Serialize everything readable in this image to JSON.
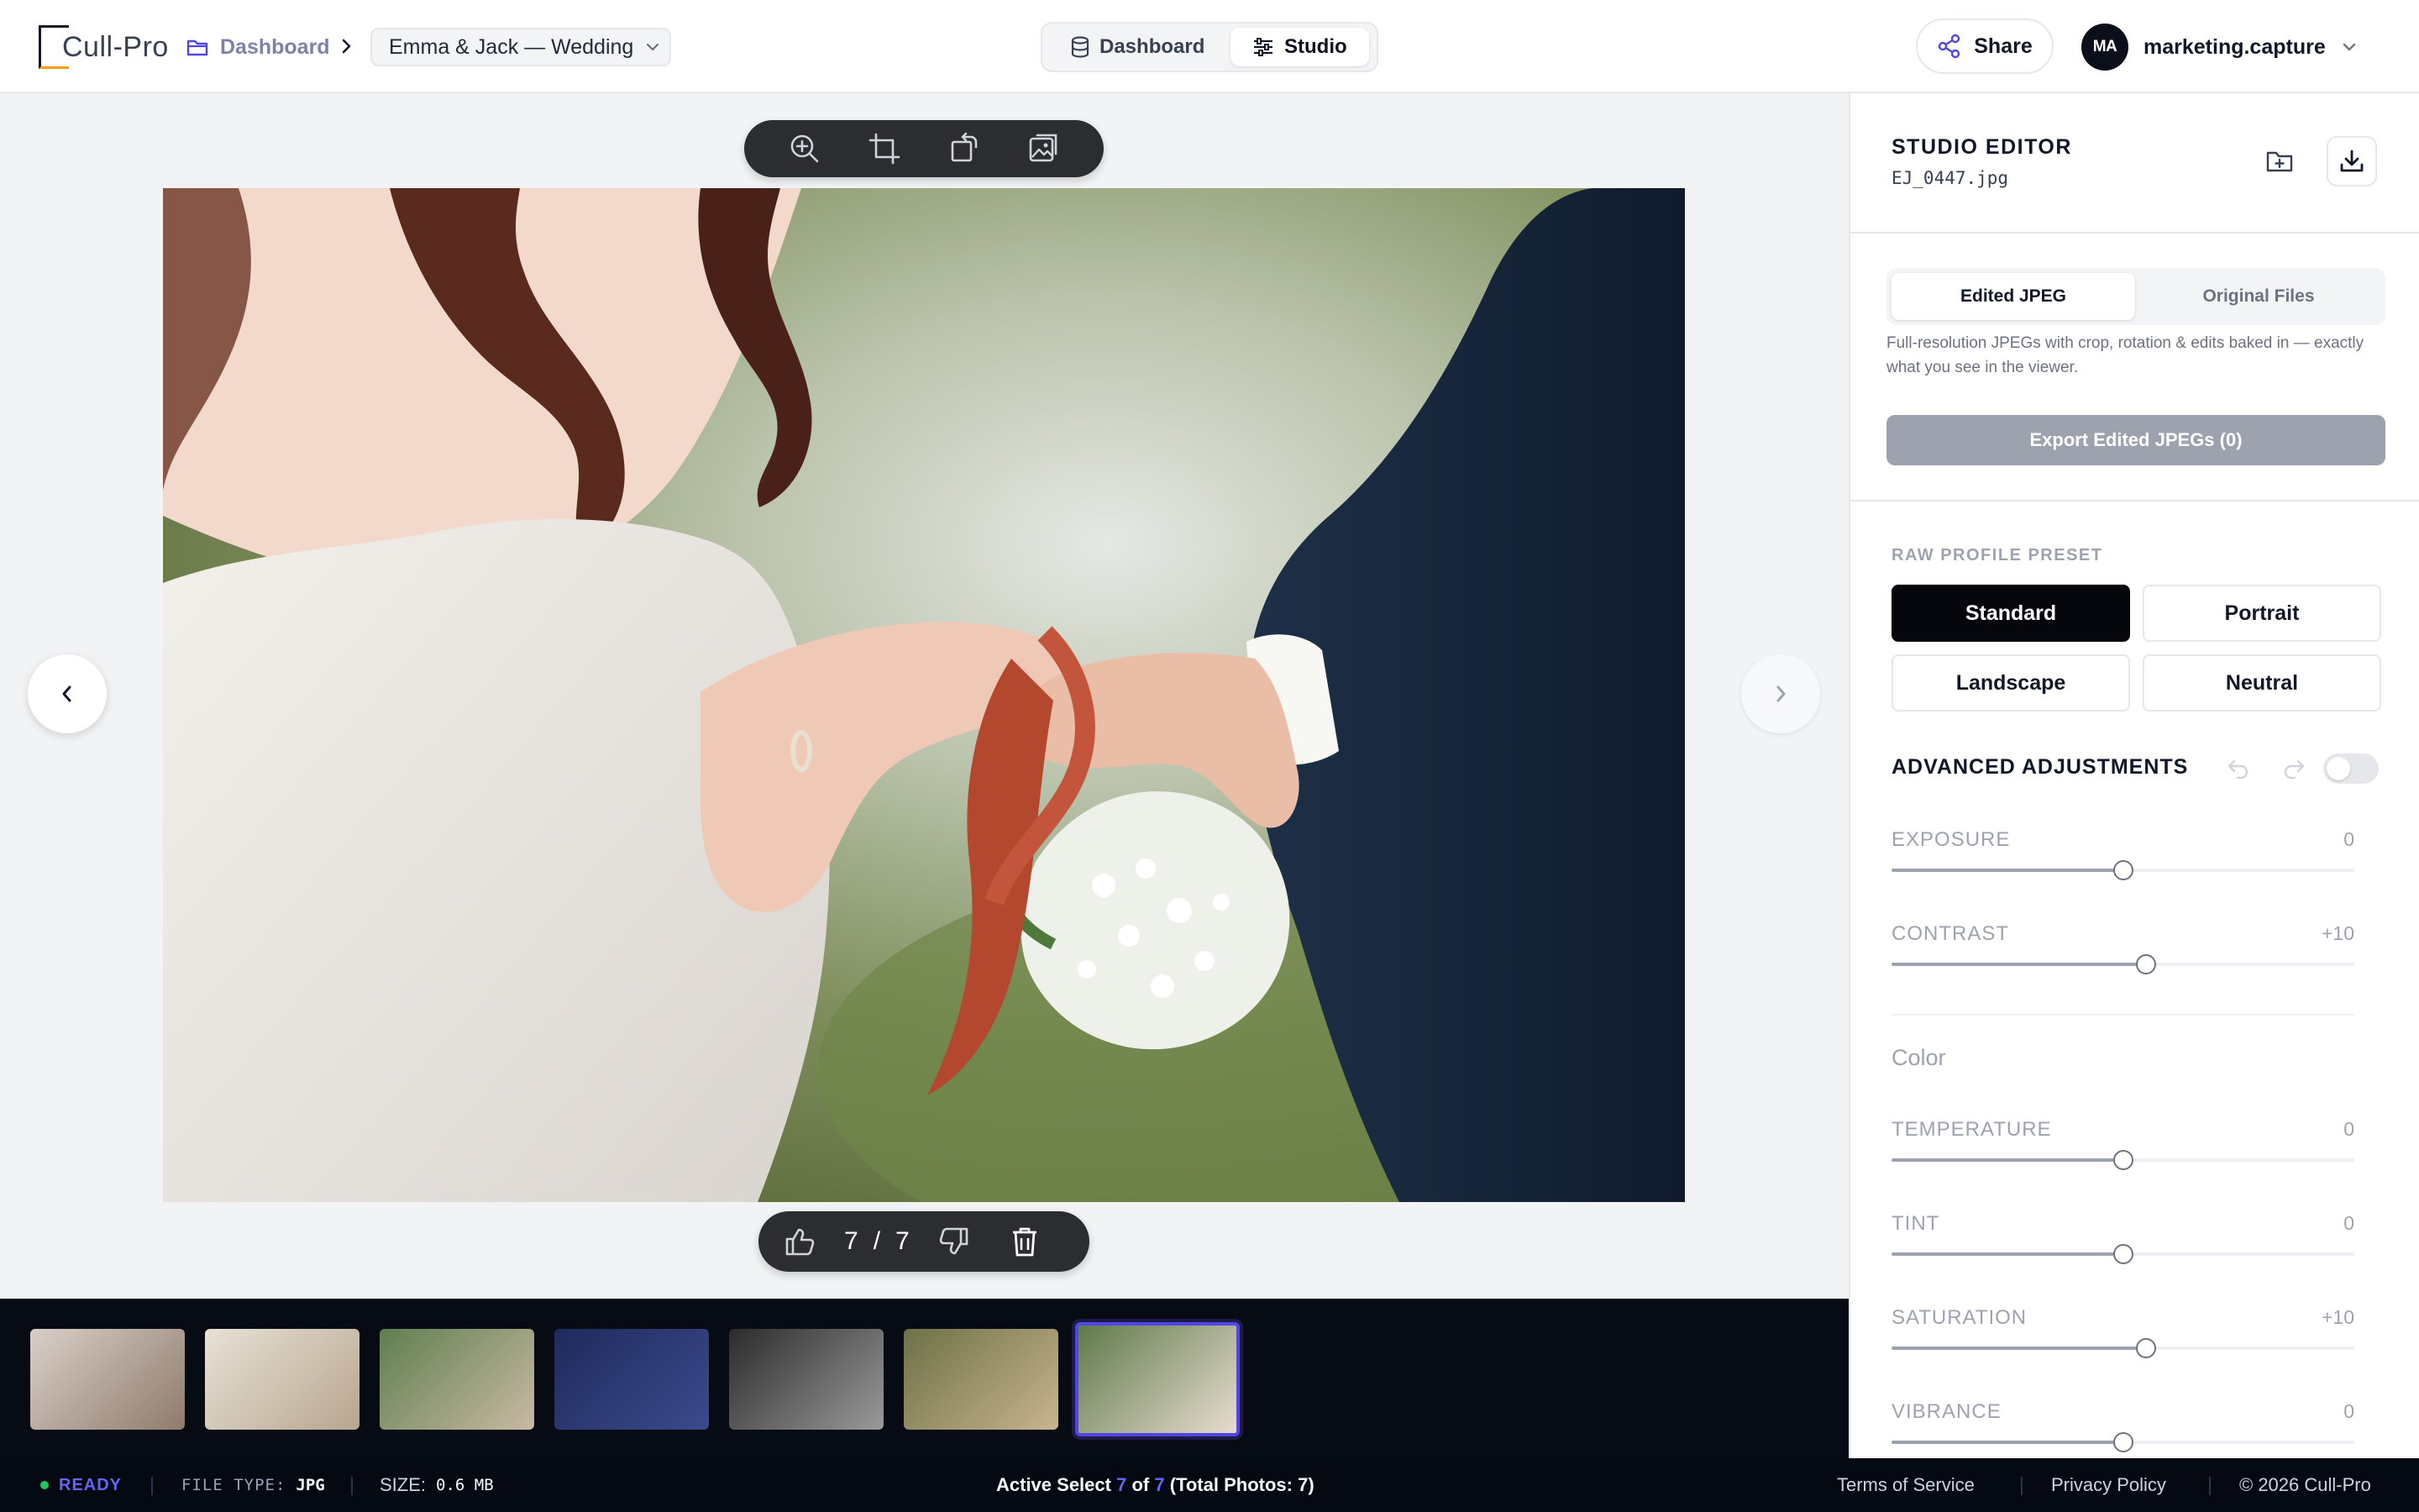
{
  "header": {
    "logo_text": "Cull-Pro",
    "breadcrumb_home": "Dashboard",
    "project_name": "Emma & Jack — Wedding",
    "modes": {
      "dashboard": "Dashboard",
      "studio": "Studio",
      "active": "Studio"
    },
    "share_label": "Share",
    "user": {
      "initials": "MA",
      "name": "marketing.capture"
    }
  },
  "viewer": {
    "counter": {
      "current": "7",
      "sep": "/",
      "total": "7"
    }
  },
  "filmstrip": {
    "thumbnails": [
      {
        "colors": [
          "#d9cfc7",
          "#8f7b6d"
        ],
        "active": false
      },
      {
        "colors": [
          "#e8e2d6",
          "#b7a58f"
        ],
        "active": false
      },
      {
        "colors": [
          "#5f7f4f",
          "#c9b9a3"
        ],
        "active": false
      },
      {
        "colors": [
          "#1f2a5c",
          "#3b4a8c"
        ],
        "active": false
      },
      {
        "colors": [
          "#2b2b2b",
          "#9a9a9a"
        ],
        "active": false
      },
      {
        "colors": [
          "#6e7148",
          "#c8b48e"
        ],
        "active": false
      },
      {
        "colors": [
          "#5f7a4a",
          "#e8dcd0"
        ],
        "active": true
      }
    ]
  },
  "footer": {
    "status": "READY",
    "file_type_label": "FILE TYPE:",
    "file_type": "JPG",
    "size_label": "SIZE:",
    "size": "0.6 MB",
    "active_prefix": "Active Select",
    "active_current": "7",
    "active_of": "of",
    "active_total": "7",
    "active_suffix": "(Total Photos: 7)",
    "terms": "Terms of Service",
    "privacy": "Privacy Policy",
    "copyright": "© 2026 Cull-Pro"
  },
  "panel": {
    "title": "STUDIO EDITOR",
    "filename": "EJ_0447.jpg",
    "export_tabs": {
      "edited": "Edited JPEG",
      "original": "Original Files",
      "active": "Edited JPEG"
    },
    "description": "Full-resolution JPEGs with crop, rotation & edits baked in — exactly what you see in the viewer.",
    "export_button": "Export Edited JPEGs (0)",
    "preset_label": "RAW PROFILE PRESET",
    "presets": [
      "Standard",
      "Portrait",
      "Landscape",
      "Neutral"
    ],
    "active_preset": "Standard",
    "advanced_title": "ADVANCED ADJUSTMENTS",
    "advanced_enabled": false,
    "adjustments": [
      {
        "name": "EXPOSURE",
        "value": "0",
        "level": 0.5
      },
      {
        "name": "CONTRAST",
        "value": "+10",
        "level": 0.55
      }
    ],
    "color_label": "Color",
    "color_adjustments": [
      {
        "name": "TEMPERATURE",
        "value": "0",
        "level": 0.5
      },
      {
        "name": "TINT",
        "value": "0",
        "level": 0.5
      },
      {
        "name": "SATURATION",
        "value": "+10",
        "level": 0.55
      },
      {
        "name": "VIBRANCE",
        "value": "0",
        "level": 0.5
      }
    ]
  },
  "colors": {
    "accent": "#4f46e5",
    "dark": "#05070d",
    "ready": "#22c55e"
  }
}
